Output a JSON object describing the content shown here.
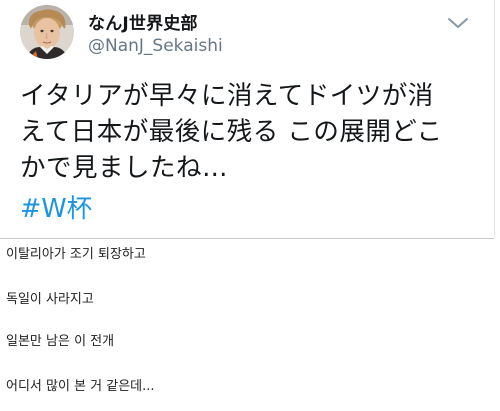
{
  "tweet": {
    "display_name": "なんJ世界史部",
    "handle": "@NanJ_Sekaishi",
    "text_line1": "イタリアが早々に消えてドイツが消",
    "text_line2": "えて日本が最後に残る この展開どこ",
    "text_line3": "かで見ましたね…",
    "hashtag": "#W杯",
    "avatar_icon": "avatar-photo",
    "more_icon": "chevron-down-icon"
  },
  "captions": [
    "이탈리아가 조기 퇴장하고",
    "독일이 사라지고",
    "일본만 남은 이 전개",
    "어디서 많이 본 거 같은데..."
  ],
  "colors": {
    "text": "#14171a",
    "handle": "#657786",
    "hashtag": "#1b95e0",
    "chevron": "#8899a6"
  }
}
